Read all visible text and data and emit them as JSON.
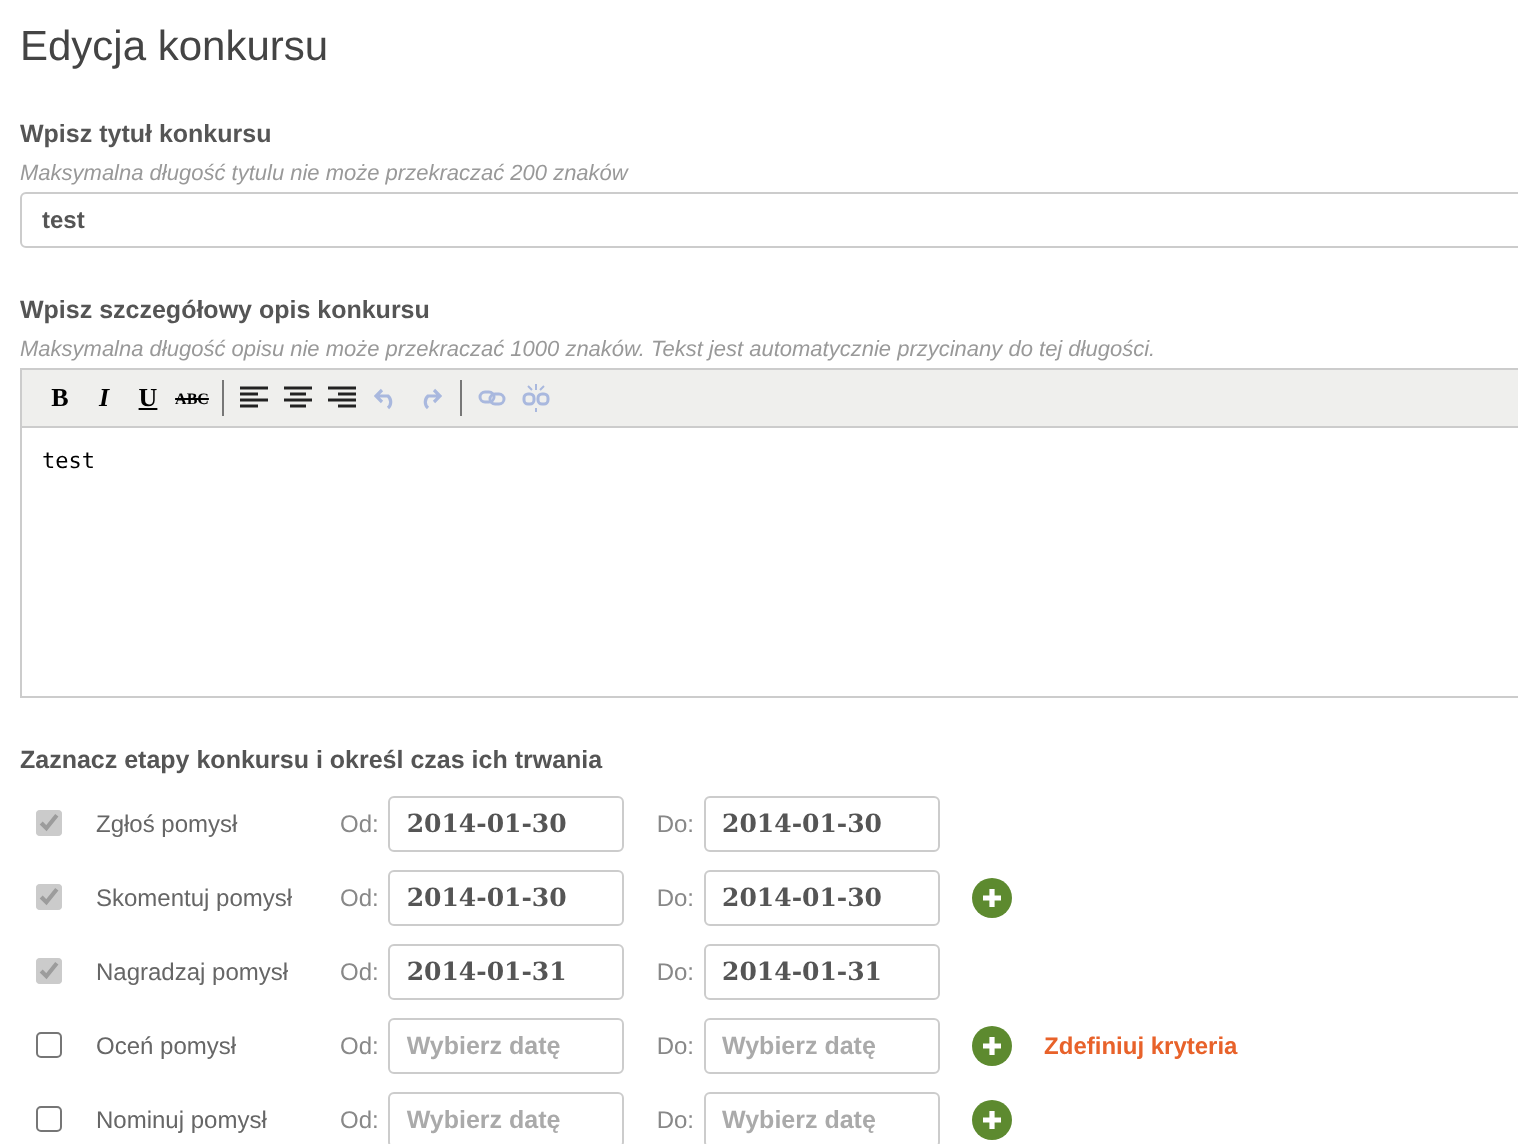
{
  "page_title": "Edycja konkursu",
  "title_field": {
    "label": "Wpisz tytuł konkursu",
    "hint": "Maksymalna długość tytulu nie może przekraczać 200 znaków",
    "value": "test"
  },
  "description_field": {
    "label": "Wpisz szczegółowy opis konkursu",
    "hint": "Maksymalna długość opisu nie może przekraczać 1000 znaków. Tekst jest automatycznie przycinany do tej długości.",
    "toolbar": [
      {
        "kind": "bold",
        "label": "B",
        "disabled": false
      },
      {
        "kind": "italic",
        "label": "I",
        "disabled": false
      },
      {
        "kind": "underline",
        "label": "U",
        "disabled": false
      },
      {
        "kind": "strike",
        "label": "ABC",
        "disabled": false
      },
      {
        "kind": "separator"
      },
      {
        "kind": "align-left",
        "disabled": false
      },
      {
        "kind": "align-center",
        "disabled": false
      },
      {
        "kind": "align-right",
        "disabled": false
      },
      {
        "kind": "undo",
        "disabled": true
      },
      {
        "kind": "redo",
        "disabled": true
      },
      {
        "kind": "separator"
      },
      {
        "kind": "link",
        "disabled": true
      },
      {
        "kind": "unlink",
        "disabled": true
      }
    ],
    "value": "test"
  },
  "stages_heading": "Zaznacz etapy konkursu i określ czas ich trwania",
  "stages": [
    {
      "name": "Zgłoś pomysł",
      "checked": true,
      "from_label": "Od:",
      "from": {
        "value": "2014-01-30"
      },
      "to_label": "Do:",
      "to": {
        "value": "2014-01-30"
      },
      "add_button": false
    },
    {
      "name": "Skomentuj pomysł",
      "checked": true,
      "from_label": "Od:",
      "from": {
        "value": "2014-01-30"
      },
      "to_label": "Do:",
      "to": {
        "value": "2014-01-30"
      },
      "add_button": true
    },
    {
      "name": "Nagradzaj pomysł",
      "checked": true,
      "from_label": "Od:",
      "from": {
        "value": "2014-01-31"
      },
      "to_label": "Do:",
      "to": {
        "value": "2014-01-31"
      },
      "add_button": false
    },
    {
      "name": "Oceń pomysł",
      "checked": false,
      "from_label": "Od:",
      "from": {
        "placeholder": "Wybierz datę"
      },
      "to_label": "Do:",
      "to": {
        "placeholder": "Wybierz datę"
      },
      "add_button": true,
      "link": "Zdefiniuj kryteria"
    },
    {
      "name": "Nominuj pomysł",
      "checked": false,
      "from_label": "Od:",
      "from": {
        "placeholder": "Wybierz datę"
      },
      "to_label": "Do:",
      "to": {
        "placeholder": "Wybierz datę"
      },
      "add_button": true
    }
  ]
}
